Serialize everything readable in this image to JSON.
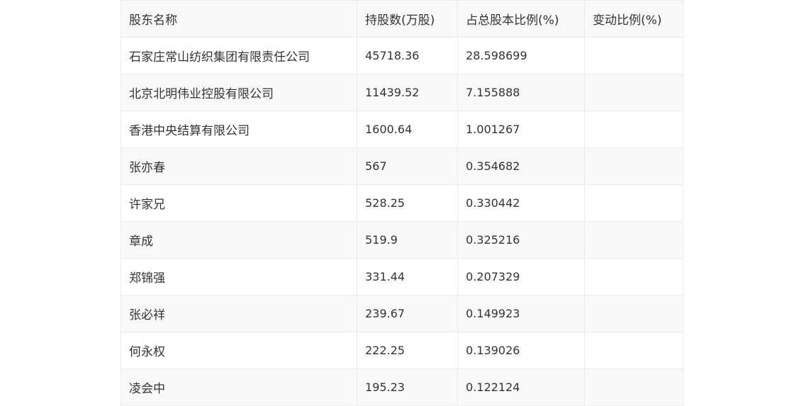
{
  "table": {
    "headers": [
      "股东名称",
      "持股数(万股)",
      "占总股本比例(%)",
      "变动比例(%)"
    ],
    "rows": [
      {
        "name": "石家庄常山纺织集团有限责任公司",
        "shares": "45718.36",
        "ratio": "28.598699",
        "change": ""
      },
      {
        "name": "北京北明伟业控股有限公司",
        "shares": "11439.52",
        "ratio": "7.155888",
        "change": ""
      },
      {
        "name": "香港中央结算有限公司",
        "shares": "1600.64",
        "ratio": "1.001267",
        "change": ""
      },
      {
        "name": "张亦春",
        "shares": "567",
        "ratio": "0.354682",
        "change": ""
      },
      {
        "name": "许家兄",
        "shares": "528.25",
        "ratio": "0.330442",
        "change": ""
      },
      {
        "name": "章成",
        "shares": "519.9",
        "ratio": "0.325216",
        "change": ""
      },
      {
        "name": "郑锦强",
        "shares": "331.44",
        "ratio": "0.207329",
        "change": ""
      },
      {
        "name": "张必祥",
        "shares": "239.67",
        "ratio": "0.149923",
        "change": ""
      },
      {
        "name": "何永权",
        "shares": "222.25",
        "ratio": "0.139026",
        "change": ""
      },
      {
        "name": "凌会中",
        "shares": "195.23",
        "ratio": "0.122124",
        "change": ""
      }
    ]
  }
}
